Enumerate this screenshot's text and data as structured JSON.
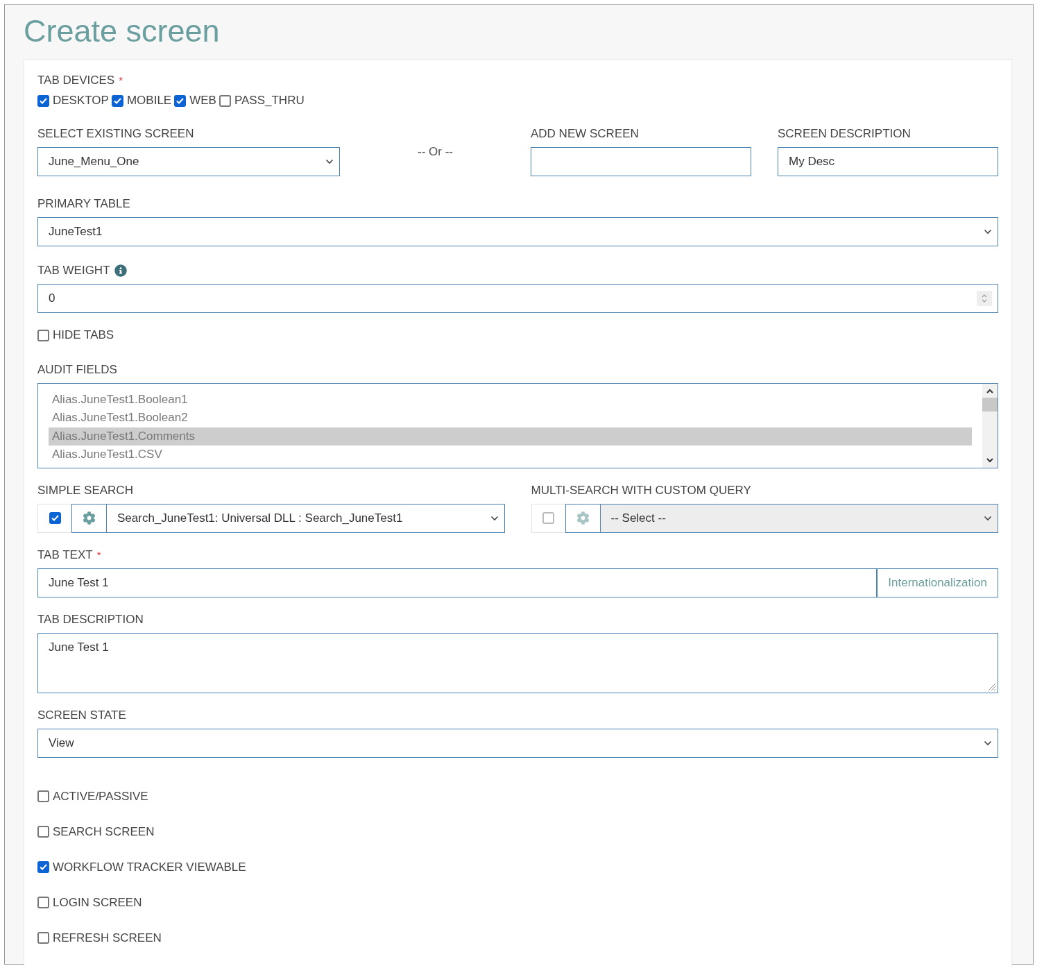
{
  "title": "Create screen",
  "tab_devices": {
    "label": "TAB DEVICES",
    "required_mark": "*",
    "options": [
      {
        "label": "DESKTOP",
        "checked": true
      },
      {
        "label": "MOBILE",
        "checked": true
      },
      {
        "label": "WEB",
        "checked": true
      },
      {
        "label": "PASS_THRU",
        "checked": false
      }
    ]
  },
  "select_existing_screen": {
    "label": "SELECT EXISTING SCREEN",
    "value": "June_Menu_One"
  },
  "or_text": "-- Or --",
  "add_new_screen": {
    "label": "ADD NEW SCREEN"
  },
  "screen_description": {
    "label": "SCREEN DESCRIPTION",
    "value": "My Desc"
  },
  "primary_table": {
    "label": "PRIMARY TABLE",
    "value": "JuneTest1"
  },
  "tab_weight": {
    "label": "TAB WEIGHT",
    "value": "0"
  },
  "hide_tabs": {
    "label": "HIDE TABS",
    "checked": false
  },
  "audit_fields": {
    "label": "AUDIT FIELDS",
    "items": [
      {
        "label": "Alias.JuneTest1.Boolean1",
        "selected": false
      },
      {
        "label": "Alias.JuneTest1.Boolean2",
        "selected": false
      },
      {
        "label": "Alias.JuneTest1.Comments",
        "selected": true
      },
      {
        "label": "Alias.JuneTest1.CSV",
        "selected": false
      }
    ]
  },
  "simple_search": {
    "label": "SIMPLE SEARCH",
    "checked": true,
    "disabled": false,
    "value": "Search_JuneTest1: Universal DLL : Search_JuneTest1"
  },
  "multi_search": {
    "label": "MULTI-SEARCH WITH CUSTOM QUERY",
    "checked": false,
    "disabled": true,
    "value": "-- Select --"
  },
  "tab_text": {
    "label": "TAB TEXT",
    "required_mark": "*",
    "value": "June Test 1",
    "button": "Internationalization"
  },
  "tab_description": {
    "label": "TAB DESCRIPTION",
    "value": "June Test 1"
  },
  "screen_state": {
    "label": "SCREEN STATE",
    "value": "View"
  },
  "options": [
    {
      "label": "ACTIVE/PASSIVE",
      "checked": false
    },
    {
      "label": "SEARCH SCREEN",
      "checked": false
    },
    {
      "label": "WORKFLOW TRACKER VIEWABLE",
      "checked": true
    },
    {
      "label": "LOGIN SCREEN",
      "checked": false
    },
    {
      "label": "REFRESH SCREEN",
      "checked": false
    }
  ]
}
